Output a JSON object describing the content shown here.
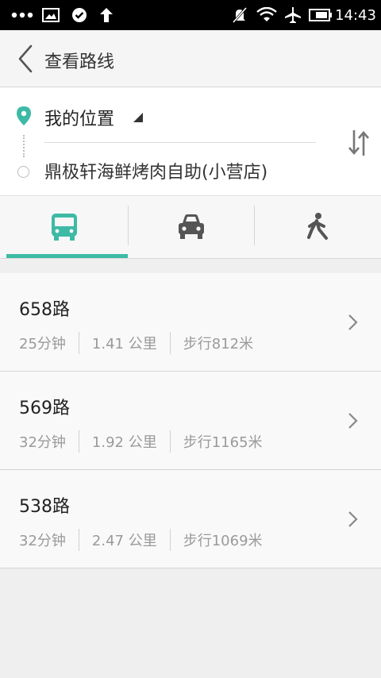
{
  "status_bar": {
    "time": "14:43",
    "icons": [
      "more-dots-icon",
      "image-icon",
      "check-circle-icon",
      "upload-arrow-icon",
      "mute-icon",
      "wifi-icon",
      "airplane-icon",
      "battery-icon"
    ]
  },
  "header": {
    "title": "查看路线"
  },
  "route": {
    "origin": "我的位置",
    "destination": "鼎极轩海鲜烤肉自助(小营店)"
  },
  "tabs": [
    "bus-icon",
    "car-icon",
    "walk-icon"
  ],
  "colors": {
    "accent": "#3dbaa5",
    "icon_gray": "#555555"
  },
  "results": [
    {
      "route": "658路",
      "duration": "25分钟",
      "distance": "1.41 公里",
      "walk": "步行812米"
    },
    {
      "route": "569路",
      "duration": "32分钟",
      "distance": "1.92 公里",
      "walk": "步行1165米"
    },
    {
      "route": "538路",
      "duration": "32分钟",
      "distance": "2.47 公里",
      "walk": "步行1069米"
    }
  ]
}
